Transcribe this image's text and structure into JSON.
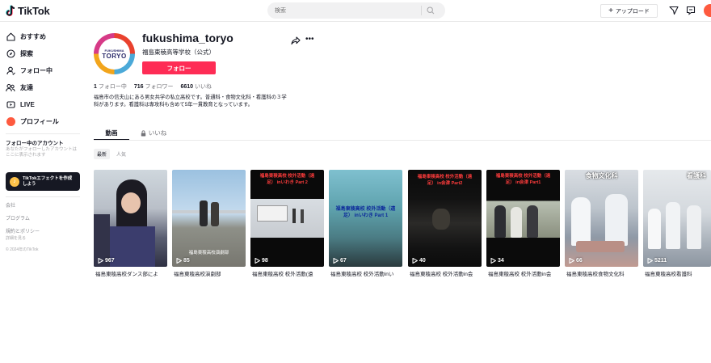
{
  "topbar": {
    "logo_text": "TikTok",
    "search_placeholder": "検索",
    "upload_label": "アップロード",
    "icons": [
      "search-icon",
      "send-icon",
      "inbox-icon",
      "avatar"
    ]
  },
  "sidebar": {
    "nav": [
      {
        "label": "おすすめ",
        "icon": "home-icon"
      },
      {
        "label": "探索",
        "icon": "compass-icon"
      },
      {
        "label": "フォロー中",
        "icon": "following-icon"
      },
      {
        "label": "友達",
        "icon": "friends-icon"
      },
      {
        "label": "LIVE",
        "icon": "live-icon"
      },
      {
        "label": "プロフィール",
        "icon": "profile-icon"
      }
    ],
    "following_heading": "フォロー中のアカウント",
    "following_note": "あなたがフォローしたアカウントはここに表示されます",
    "effect_button": "TikTokエフェクトを作成しよう",
    "links": [
      "会社",
      "プログラム",
      "規約とポリシー"
    ],
    "more": "詳細を見る",
    "copyright": "© 2024年のTikTok"
  },
  "profile": {
    "username": "fukushima_toryo",
    "display_name": "福島東稜高等学校（公式）",
    "follow_label": "フォロー",
    "avatar_text_top": "FUKUSHIMA",
    "avatar_text_main": "TORYO",
    "stats": {
      "following_count": "1",
      "following_label": "フォロー中",
      "followers_count": "716",
      "followers_label": "フォロワー",
      "likes_count": "6610",
      "likes_label": "いいね"
    },
    "bio": "福島市の信夫山にある男女共学の私立高校です。普通科・食物文化科・看護科の３学科があります。看護科は専攻科も含めて5年一貫教育となっています。"
  },
  "tabs": {
    "videos": "動画",
    "likes": "いいね"
  },
  "chips": [
    "最新",
    "人気"
  ],
  "videos": [
    {
      "views": "967",
      "caption": "福島東稜高校ダンス部によ",
      "overlay": ""
    },
    {
      "views": "85",
      "caption": "福島東稜高校演劇部",
      "overlay": "福島東稜高校演劇部"
    },
    {
      "views": "98",
      "caption": "福島東稜高校 校外活動(遠",
      "overlay": "福島東稜高校 校外活動（遠足） inいわき Part 2"
    },
    {
      "views": "67",
      "caption": "福島東稜高校 校外活動inい",
      "overlay": "福島東稜高校 校外活動（遠足） inいわき Part 1"
    },
    {
      "views": "40",
      "caption": "福島東稜高校 校外活動in会",
      "overlay": "福島東稜高校 校外活動（遠足） in会津 Part2"
    },
    {
      "views": "34",
      "caption": "福島東稜高校 校外活動in会",
      "overlay": "福島東稜高校 校外活動（遠足） in会津 Part1"
    },
    {
      "views": "66",
      "caption": "福島東稜高校食物文化科",
      "overlay": "食物文化科"
    },
    {
      "views": "5211",
      "caption": "福島東稜高校看護科",
      "overlay": "看護科"
    }
  ],
  "colors": {
    "accent": "#fe2c55",
    "text": "#161823",
    "muted": "#737378"
  }
}
